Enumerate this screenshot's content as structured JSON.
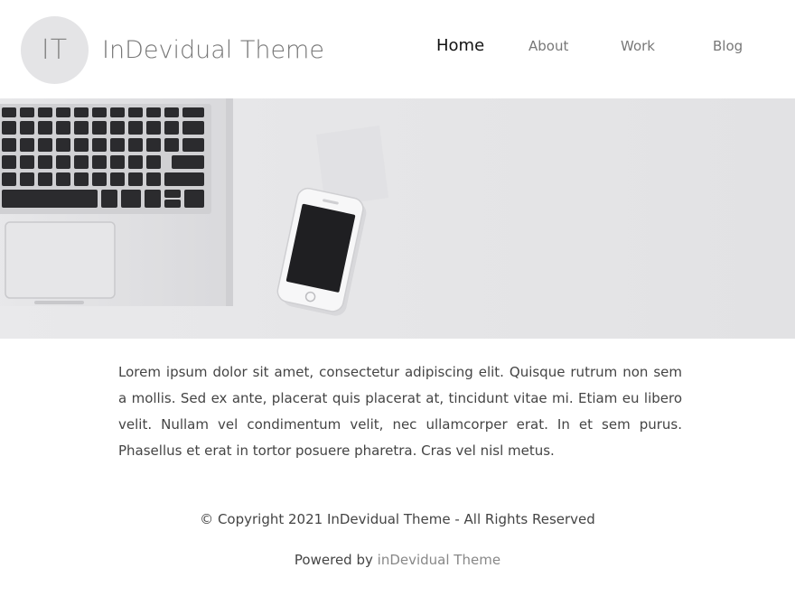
{
  "header": {
    "logo_initials": "IT",
    "site_title": "InDevidual Theme"
  },
  "nav": {
    "items": [
      {
        "label": "Home",
        "active": true
      },
      {
        "label": "About",
        "active": false
      },
      {
        "label": "Work",
        "active": false
      },
      {
        "label": "Blog",
        "active": false
      }
    ]
  },
  "hero": {
    "image": "laptop-and-phone-photo"
  },
  "main": {
    "paragraph": "Lorem ipsum dolor sit amet, consectetur adipiscing elit. Quisque rutrum non sem a mollis. Sed ex ante, placerat quis placerat at, tincidunt vitae mi. Etiam eu libero velit. Nullam vel condimentum velit, nec ullamcorper erat. In et sem purus. Phasellus et erat in tortor posuere pharetra. Cras vel nisl metus."
  },
  "footer": {
    "copyright": "© Copyright 2021 InDevidual Theme - All Rights Reserved",
    "powered_prefix": "Powered by",
    "powered_link": "inDevidual Theme"
  },
  "colors": {
    "hero_bg": "#e6e6e8",
    "logo_bg": "#e4e4e6",
    "nav_active": "#111111",
    "nav_inactive": "#777777"
  }
}
